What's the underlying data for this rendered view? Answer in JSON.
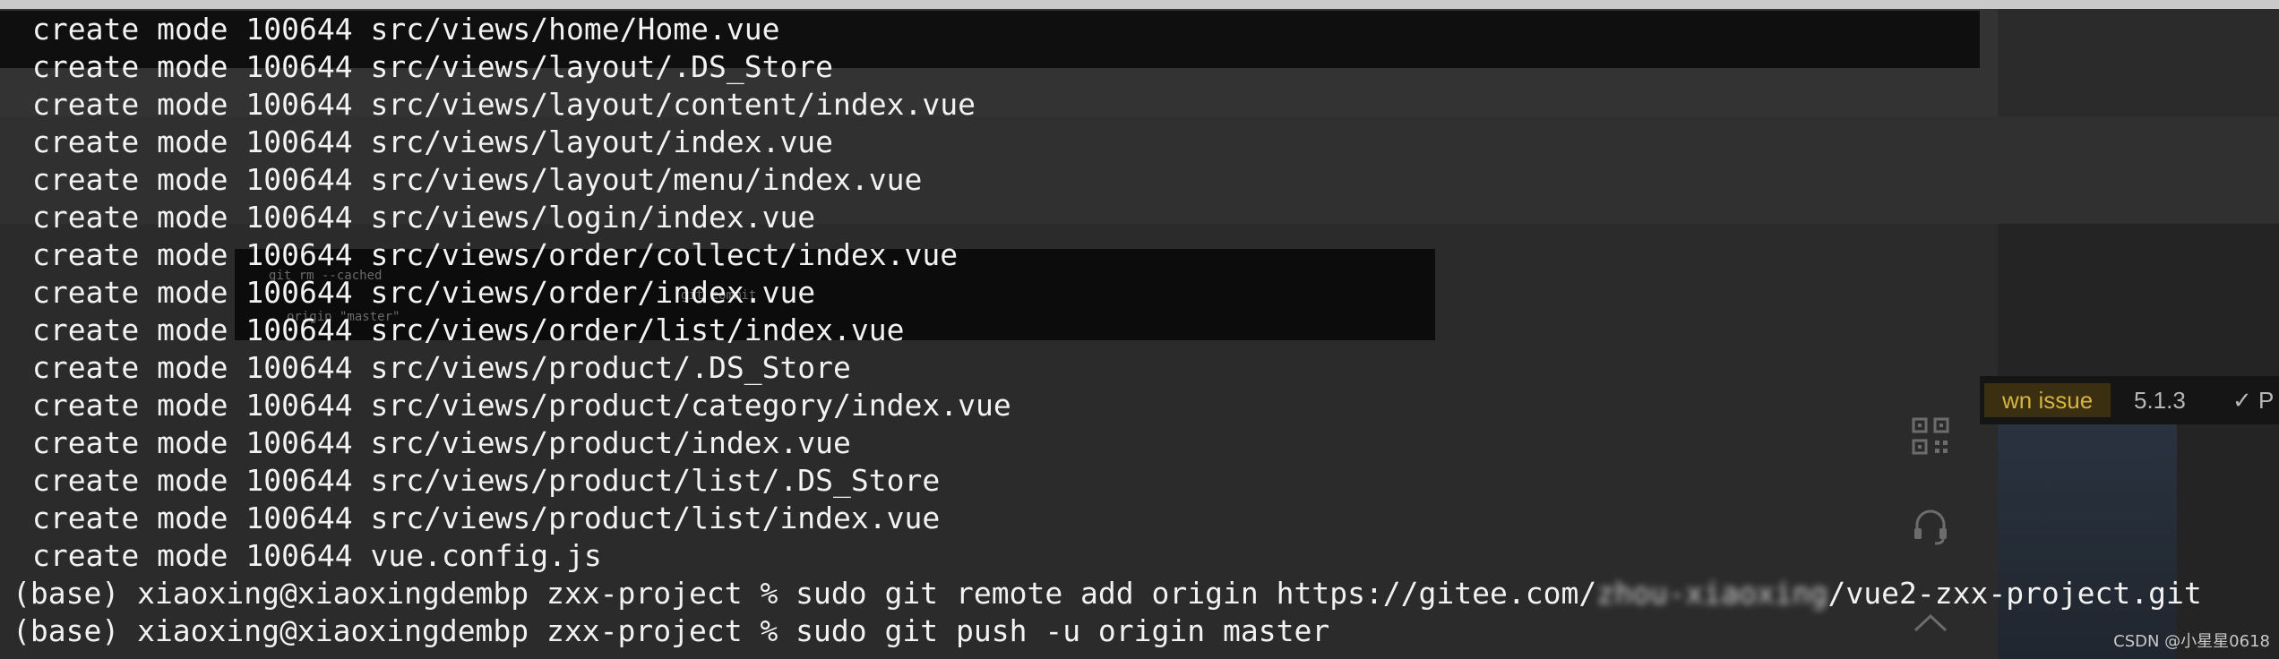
{
  "terminal": {
    "lines": [
      "create mode 100644 src/views/home/Home.vue",
      "create mode 100644 src/views/layout/.DS_Store",
      "create mode 100644 src/views/layout/content/index.vue",
      "create mode 100644 src/views/layout/index.vue",
      "create mode 100644 src/views/layout/menu/index.vue",
      "create mode 100644 src/views/login/index.vue",
      "create mode 100644 src/views/order/collect/index.vue",
      "create mode 100644 src/views/order/index.vue",
      "create mode 100644 src/views/order/list/index.vue",
      "create mode 100644 src/views/product/.DS_Store",
      "create mode 100644 src/views/product/category/index.vue",
      "create mode 100644 src/views/product/index.vue",
      "create mode 100644 src/views/product/list/.DS_Store",
      "create mode 100644 src/views/product/list/index.vue",
      "create mode 100644 vue.config.js"
    ],
    "prompt_remote": {
      "prefix": "(base) xiaoxing@xiaoxingdembp zxx-project % sudo git remote add origin https://gitee.com/",
      "masked": "zhou-xiaoxing",
      "suffix": "/vue2-zxx-project.git"
    },
    "prompt_push": "(base) xiaoxing@xiaoxingdembp zxx-project % sudo git push -u origin master"
  },
  "background": {
    "badge_issue": "wn issue",
    "badge_version": "5.1.3",
    "badge_check": "✓ P",
    "faint_1": "git rm --cached",
    "faint_2": "git commit",
    "faint_3": "origin \"master\""
  },
  "side_icons": [
    "qr-code-icon",
    "headset-icon",
    "chevron-up-icon"
  ],
  "watermark": "CSDN @小星星0618",
  "colors": {
    "terminal_bg": "#0f0f0f",
    "terminal_text": "#f2f2f2",
    "issue_badge": "#d6b340"
  }
}
